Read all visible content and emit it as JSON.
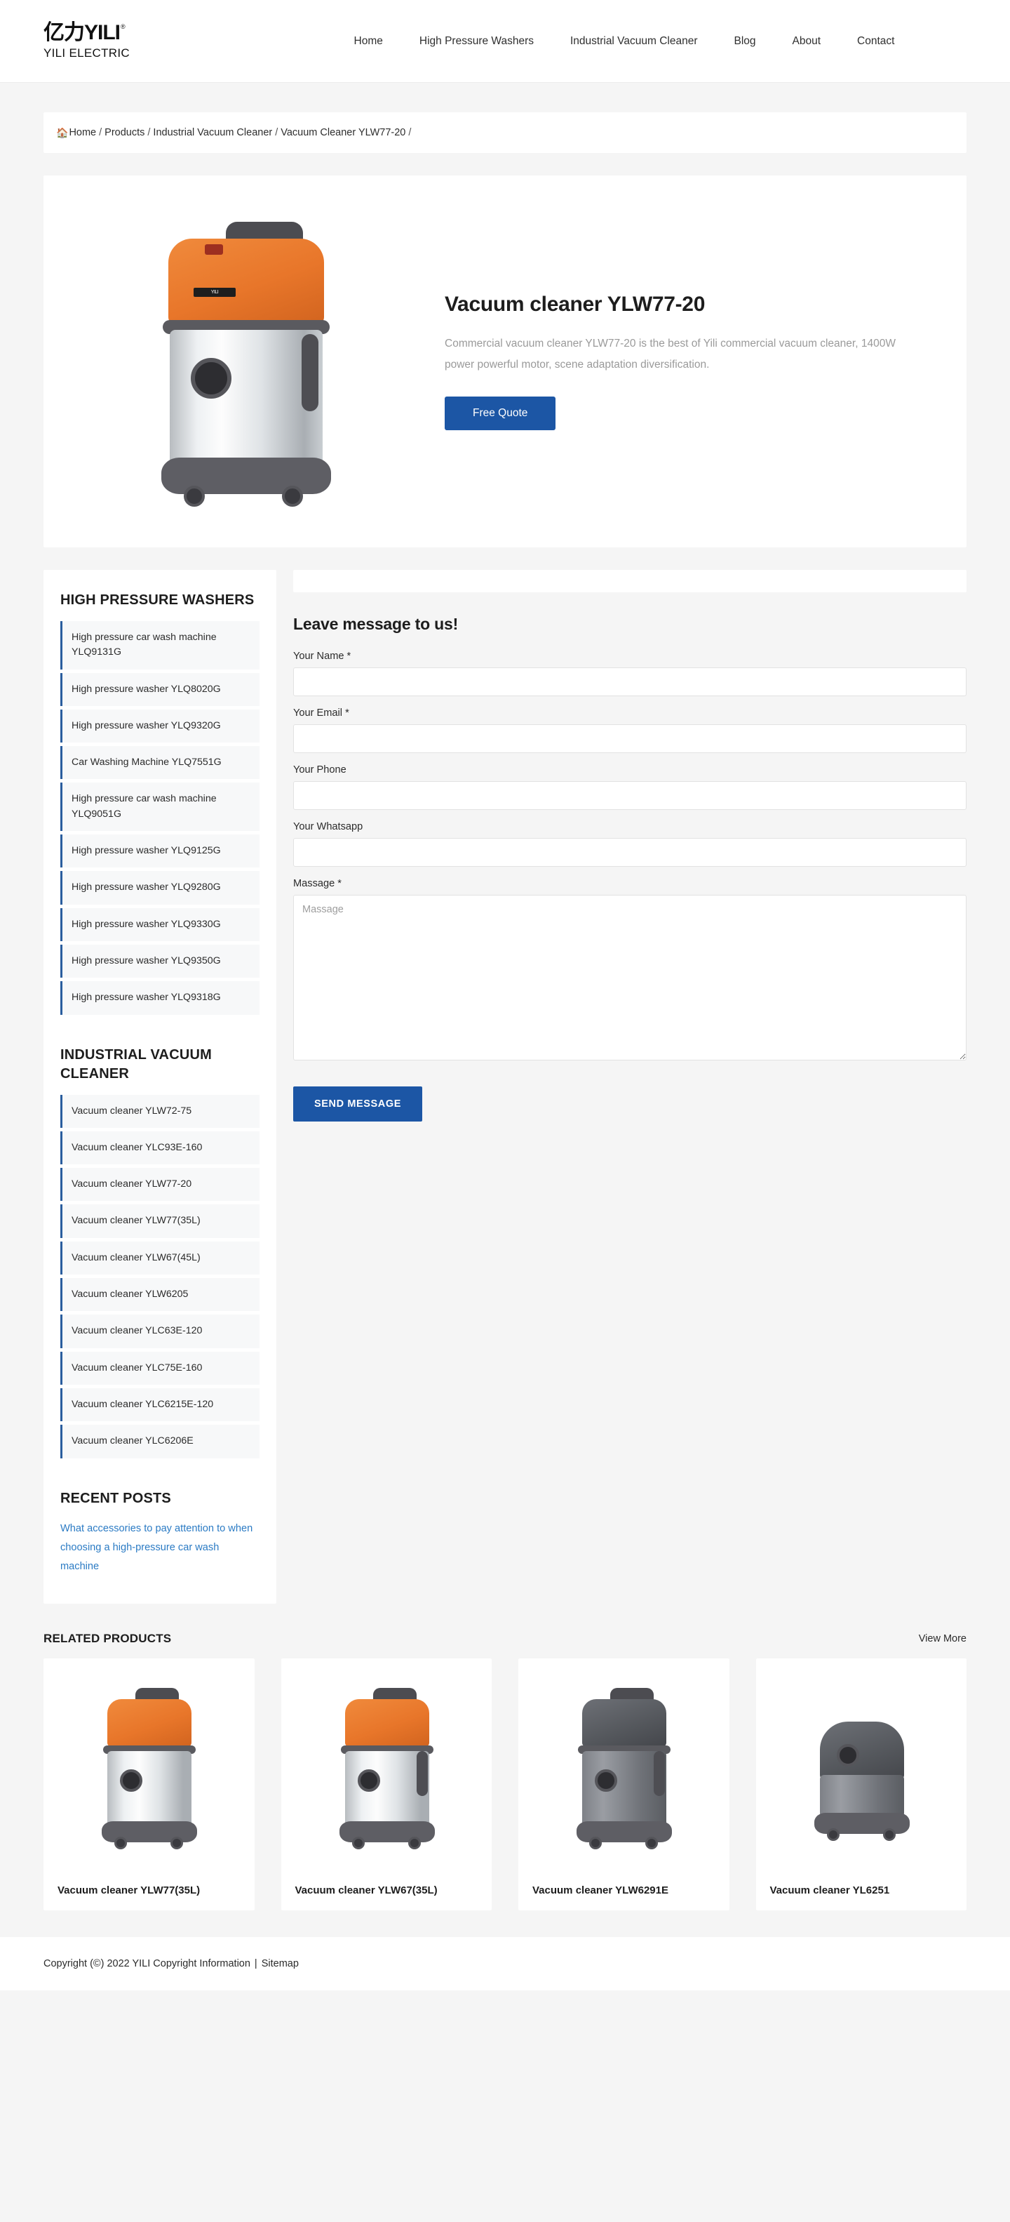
{
  "header": {
    "logo_mark": "亿力YILI",
    "logo_registered": "®",
    "logo_sub": "YILI ELECTRIC",
    "nav": [
      {
        "label": "Home"
      },
      {
        "label": "High Pressure Washers"
      },
      {
        "label": "Industrial Vacuum Cleaner"
      },
      {
        "label": "Blog"
      },
      {
        "label": "About"
      },
      {
        "label": "Contact"
      }
    ]
  },
  "breadcrumb": {
    "home_icon": "home-icon",
    "items": [
      {
        "label": "Home"
      },
      {
        "label": "Products"
      },
      {
        "label": "Industrial Vacuum Cleaner"
      },
      {
        "label": "Vacuum Cleaner YLW77-20"
      }
    ],
    "separator": "/"
  },
  "hero": {
    "title": "Vacuum cleaner YLW77-20",
    "description": "Commercial vacuum cleaner YLW77-20 is the best of Yili commercial vacuum cleaner, 1400W power powerful motor, scene adaptation diversification.",
    "cta_label": "Free Quote",
    "image_alt": "Orange and stainless steel wet dry vacuum cleaner YLW77-20"
  },
  "sidebar": {
    "high_pressure": {
      "title": "HIGH PRESSURE WASHERS",
      "items": [
        {
          "label": "High pressure car wash machine YLQ9131G"
        },
        {
          "label": "High pressure washer YLQ8020G"
        },
        {
          "label": "High pressure washer YLQ9320G"
        },
        {
          "label": "Car Washing Machine YLQ7551G"
        },
        {
          "label": "High pressure car wash machine YLQ9051G"
        },
        {
          "label": "High pressure washer YLQ9125G"
        },
        {
          "label": "High pressure washer YLQ9280G"
        },
        {
          "label": "High pressure washer YLQ9330G"
        },
        {
          "label": "High pressure washer YLQ9350G"
        },
        {
          "label": "High pressure washer YLQ9318G"
        }
      ]
    },
    "vacuum": {
      "title": "INDUSTRIAL VACUUM CLEANER",
      "items": [
        {
          "label": "Vacuum cleaner YLW72-75"
        },
        {
          "label": "Vacuum cleaner YLC93E-160"
        },
        {
          "label": "Vacuum cleaner YLW77-20"
        },
        {
          "label": "Vacuum cleaner YLW77(35L)"
        },
        {
          "label": "Vacuum cleaner YLW67(45L)"
        },
        {
          "label": "Vacuum cleaner YLW6205"
        },
        {
          "label": "Vacuum cleaner YLC63E-120"
        },
        {
          "label": "Vacuum cleaner YLC75E-160"
        },
        {
          "label": "Vacuum cleaner YLC6215E-120"
        },
        {
          "label": "Vacuum cleaner YLC6206E"
        }
      ]
    },
    "recent_posts": {
      "title": "RECENT POSTS",
      "items": [
        {
          "label": "What accessories to pay attention to when choosing a high-pressure car wash machine"
        }
      ]
    }
  },
  "form": {
    "heading": "Leave message to us!",
    "fields": [
      {
        "label": "Your Name *",
        "value": "",
        "placeholder": ""
      },
      {
        "label": "Your Email *",
        "value": "",
        "placeholder": ""
      },
      {
        "label": "Your Phone",
        "value": "",
        "placeholder": ""
      },
      {
        "label": "Your Whatsapp",
        "value": "",
        "placeholder": ""
      }
    ],
    "message": {
      "label": "Massage *",
      "value": "",
      "placeholder": "Massage"
    },
    "submit_label": "SEND MESSAGE"
  },
  "related": {
    "title": "RELATED PRODUCTS",
    "view_more_label": "View More",
    "products": [
      {
        "name": "Vacuum cleaner YLW77(35L)",
        "style": "orange-steel"
      },
      {
        "name": "Vacuum cleaner YLW67(35L)",
        "style": "orange-steel-hose"
      },
      {
        "name": "Vacuum cleaner YLW6291E",
        "style": "dark-gray"
      },
      {
        "name": "Vacuum cleaner YL6251",
        "style": "gray-round"
      }
    ]
  },
  "footer": {
    "copyright": "Copyright (©) 2022 YILI Copyright Information",
    "divider": "|",
    "sitemap_label": "Sitemap"
  },
  "colors": {
    "accent_blue": "#1c56a5",
    "link_blue": "#2b7bc4",
    "page_bg": "#f5f5f5",
    "card_bg": "#ffffff",
    "list_item_bg": "#f7f8f9",
    "list_accent": "#2a5d9e",
    "product_orange": "#e8762a"
  }
}
